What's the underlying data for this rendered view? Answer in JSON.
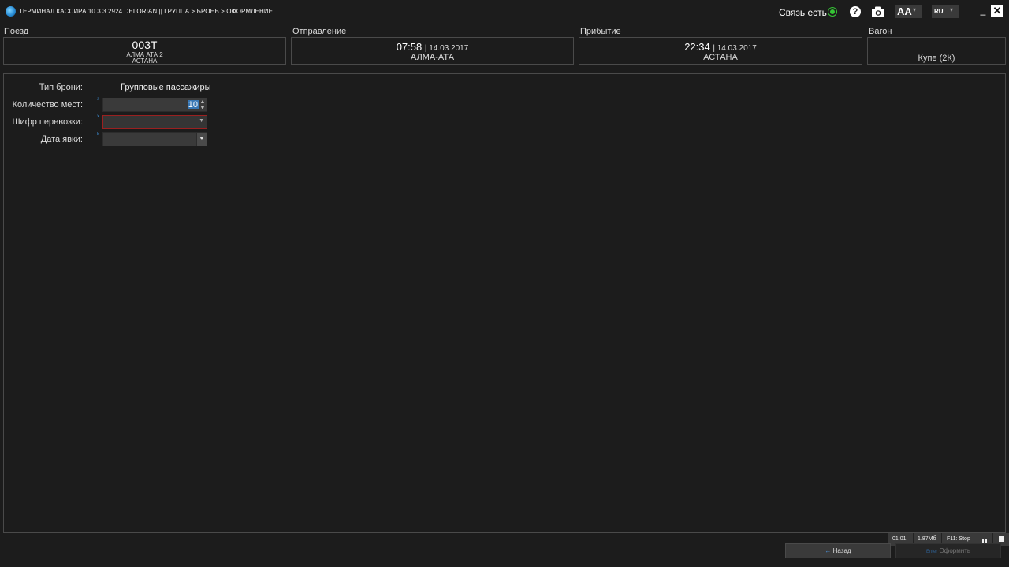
{
  "titlebar": {
    "title": "ТЕРМИНАЛ КАССИРА 10.3.3.2924  DELORIAN    ||  ГРУППА > БРОНЬ > ОФОРМЛЕНИЕ",
    "connection_status": "Связь есть",
    "font_size_button": "AA",
    "language": "RU",
    "help_icon": "?",
    "minimize": "_",
    "close": "✕"
  },
  "train": {
    "label": "Поезд",
    "number": "003Т",
    "from": "АЛМА АТА 2",
    "to": "АСТАНА"
  },
  "departure": {
    "label": "Отправление",
    "time": "07:58",
    "date": "14.03.2017",
    "station": "АЛМА-АТА"
  },
  "arrival": {
    "label": "Прибытие",
    "time": "22:34",
    "date": "14.03.2017",
    "station": "АСТАНА"
  },
  "wagon": {
    "label": "Вагон",
    "value": "Купе (2К)"
  },
  "form": {
    "booking_type_label": "Тип брони:",
    "booking_type_value": "Групповые пассажиры",
    "seats_label": "Количество мест:",
    "seats_hotkey": "s",
    "seats_value": "10",
    "transport_code_label": "Шифр перевозки:",
    "transport_code_hotkey": "x",
    "transport_code_value": "",
    "appearance_date_label": "Дата явки:",
    "appearance_date_hotkey": "в",
    "appearance_date_value": ""
  },
  "status_strip": {
    "timer": "01:01",
    "memory": "1.87Мб",
    "f11": "F11: Stop"
  },
  "buttons": {
    "back": "Назад",
    "back_arrow": "←",
    "submit": "Оформить",
    "submit_hotkey": "Enter"
  },
  "colors": {
    "background": "#1c1c1c",
    "accent": "#3777b5",
    "status_ok": "#35c535",
    "error_border": "#9a2020"
  }
}
